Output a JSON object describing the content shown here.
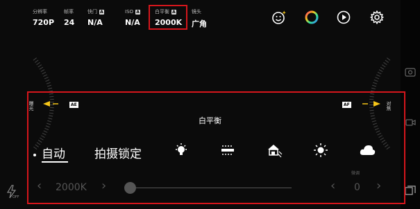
{
  "info": [
    {
      "label": "分辨率",
      "value": "720P",
      "badge": ""
    },
    {
      "label": "帧率",
      "value": "24",
      "badge": ""
    },
    {
      "label": "快门",
      "value": "N/A",
      "badge": "A"
    },
    {
      "label": "ISO",
      "value": "N/A",
      "badge": "A"
    },
    {
      "label": "白平衡",
      "value": "2000K",
      "badge": "A"
    },
    {
      "label": "镜头",
      "value": "广角",
      "badge": ""
    }
  ],
  "scales": {
    "left_label": "曝光",
    "left_badge": "AE",
    "right_label": "对焦",
    "right_badge": "AF"
  },
  "panel": {
    "title": "白平衡",
    "modes": [
      "自动",
      "拍摄锁定"
    ],
    "presets": [
      "incandescent-icon",
      "fluorescent-icon",
      "shade-icon",
      "sunny-icon",
      "cloudy-icon"
    ],
    "value": "2000K",
    "fine_label": "微调",
    "fine_value": "0"
  },
  "flash_label": "OFF",
  "colors": {
    "highlight": "#d6161c",
    "accent": "#f5c518"
  }
}
